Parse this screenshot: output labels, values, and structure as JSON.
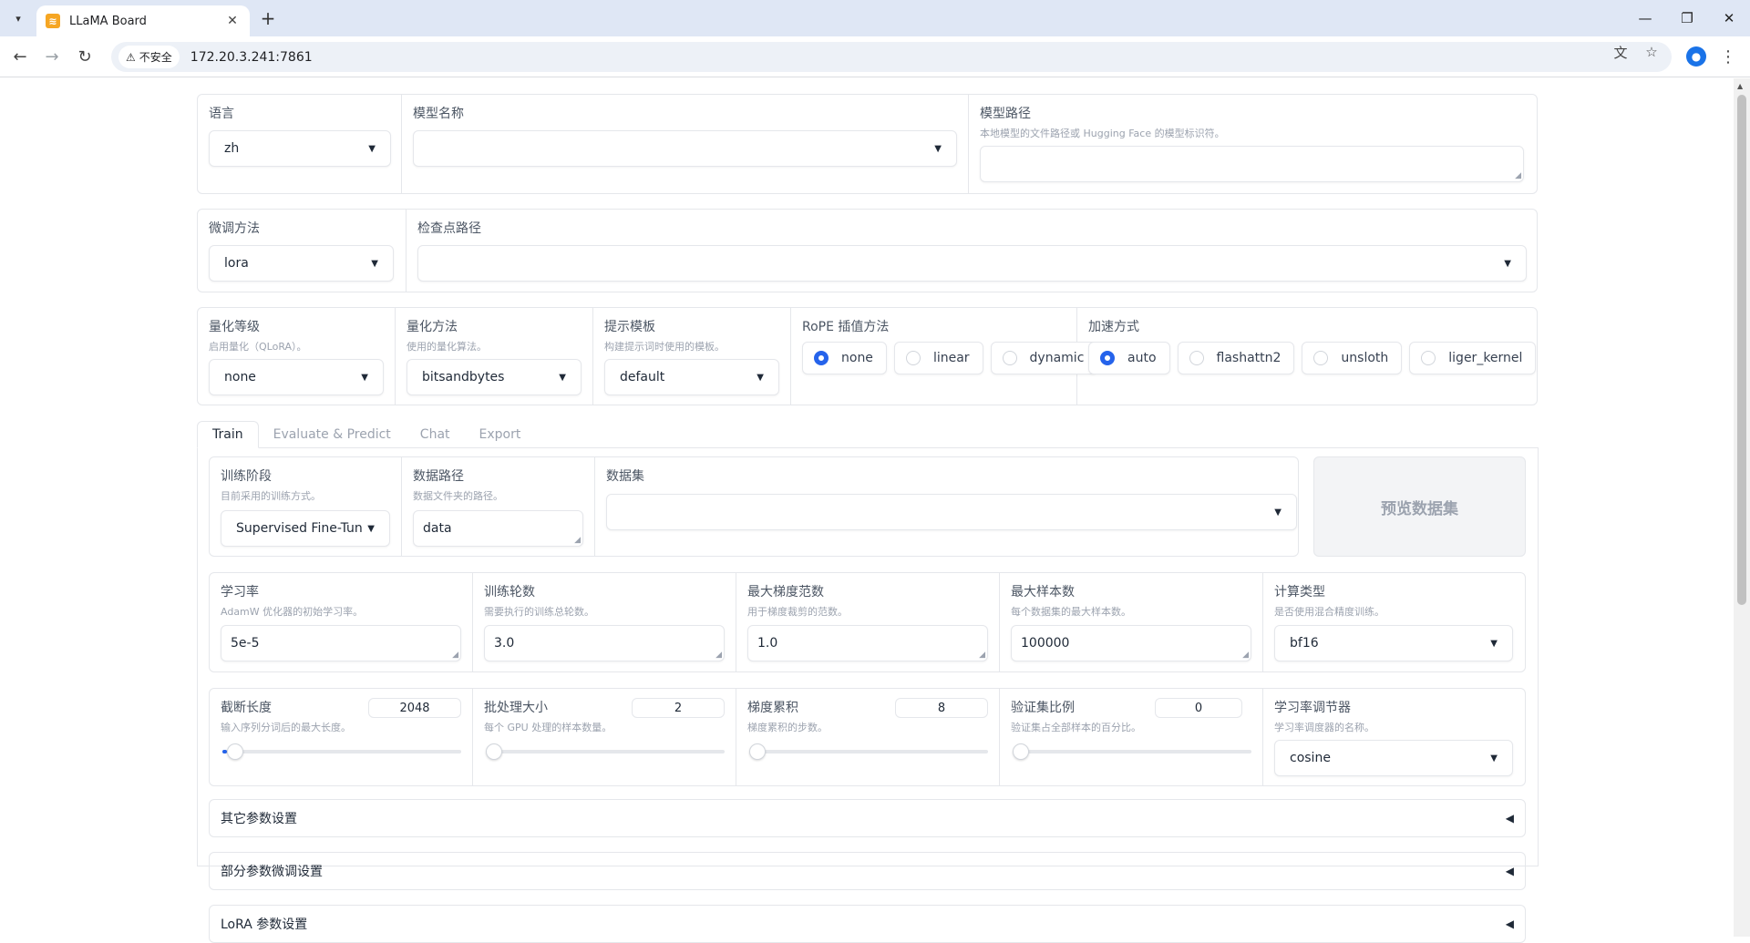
{
  "browser": {
    "tab_title": "LLaMA Board",
    "security_label": "不安全",
    "url": "172.20.3.241:7861"
  },
  "top": {
    "lang": {
      "label": "语言",
      "value": "zh"
    },
    "model_name": {
      "label": "模型名称",
      "value": ""
    },
    "model_path": {
      "label": "模型路径",
      "info": "本地模型的文件路径或 Hugging Face 的模型标识符。",
      "value": ""
    }
  },
  "finetune": {
    "method": {
      "label": "微调方法",
      "value": "lora"
    },
    "checkpoint": {
      "label": "检查点路径",
      "value": ""
    }
  },
  "advanced": {
    "quant_bit": {
      "label": "量化等级",
      "info": "启用量化（QLoRA）。",
      "value": "none"
    },
    "quant_method": {
      "label": "量化方法",
      "info": "使用的量化算法。",
      "value": "bitsandbytes"
    },
    "template": {
      "label": "提示模板",
      "info": "构建提示词时使用的模板。",
      "value": "default"
    },
    "rope": {
      "label": "RoPE 插值方法",
      "options": [
        "none",
        "linear",
        "dynamic"
      ],
      "selected": "none"
    },
    "booster": {
      "label": "加速方式",
      "options": [
        "auto",
        "flashattn2",
        "unsloth",
        "liger_kernel"
      ],
      "selected": "auto"
    }
  },
  "tabs": [
    "Train",
    "Evaluate & Predict",
    "Chat",
    "Export"
  ],
  "train": {
    "stage": {
      "label": "训练阶段",
      "info": "目前采用的训练方式。",
      "value": "Supervised Fine-Tuning"
    },
    "dataset_dir": {
      "label": "数据路径",
      "info": "数据文件夹的路径。",
      "value": "data"
    },
    "dataset": {
      "label": "数据集",
      "value": ""
    },
    "preview_btn": "预览数据集",
    "lr": {
      "label": "学习率",
      "info": "AdamW 优化器的初始学习率。",
      "value": "5e-5"
    },
    "epochs": {
      "label": "训练轮数",
      "info": "需要执行的训练总轮数。",
      "value": "3.0"
    },
    "max_grad_norm": {
      "label": "最大梯度范数",
      "info": "用于梯度裁剪的范数。",
      "value": "1.0"
    },
    "max_samples": {
      "label": "最大样本数",
      "info": "每个数据集的最大样本数。",
      "value": "100000"
    },
    "compute_type": {
      "label": "计算类型",
      "info": "是否使用混合精度训练。",
      "value": "bf16"
    },
    "cutoff_len": {
      "label": "截断长度",
      "info": "输入序列分词后的最大长度。",
      "value": "2048",
      "fraction": 0.02
    },
    "batch_size": {
      "label": "批处理大小",
      "info": "每个 GPU 处理的样本数量。",
      "value": "2",
      "fraction": 0.0
    },
    "grad_accum": {
      "label": "梯度累积",
      "info": "梯度累积的步数。",
      "value": "8",
      "fraction": 0.0
    },
    "val_size": {
      "label": "验证集比例",
      "info": "验证集占全部样本的百分比。",
      "value": "0",
      "fraction": 0.0
    },
    "lr_scheduler": {
      "label": "学习率调节器",
      "info": "学习率调度器的名称。",
      "value": "cosine"
    },
    "accordions": [
      "其它参数设置",
      "部分参数微调设置",
      "LoRA 参数设置"
    ]
  },
  "colors": {
    "accent": "#2563eb",
    "border": "#e5e7eb",
    "favicon": "#f6a623"
  }
}
